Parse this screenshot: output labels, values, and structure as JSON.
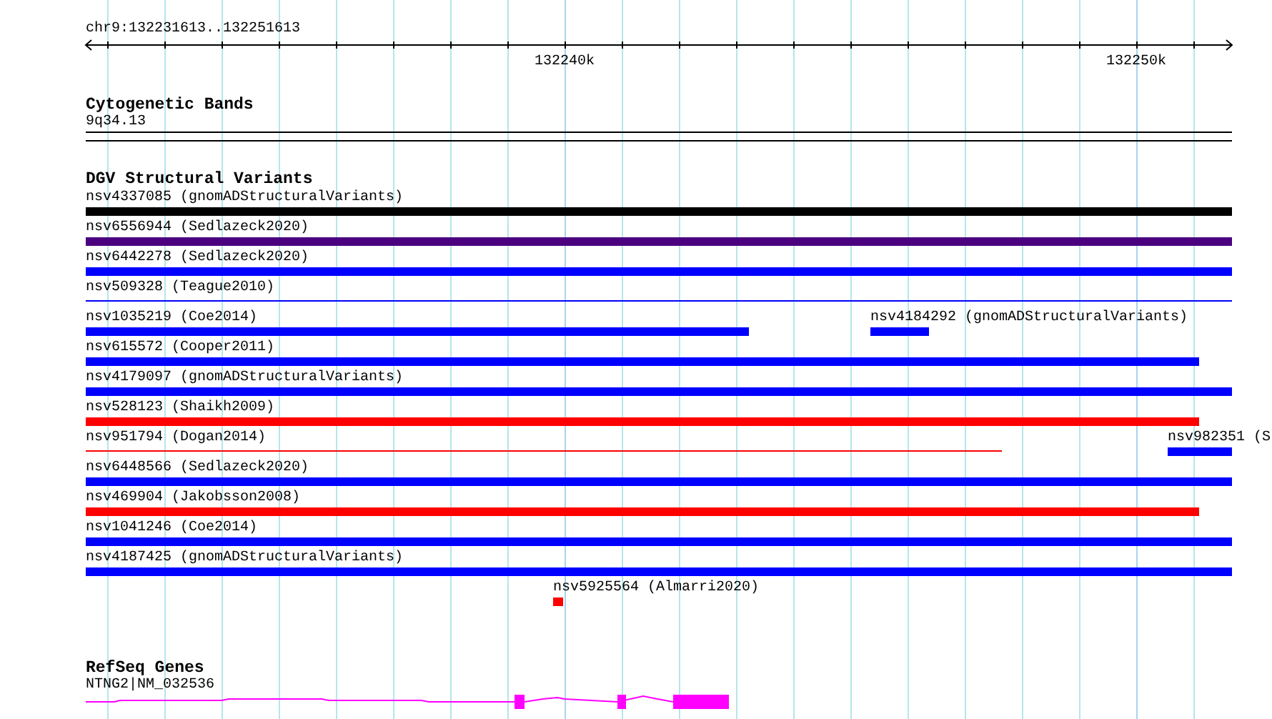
{
  "ruler": {
    "location": "chr9:132231613..132251613",
    "tick_labels": [
      "132240k",
      "132250k"
    ]
  },
  "cytogenetic_bands": {
    "title": "Cytogenetic Bands",
    "band": "9q34.13"
  },
  "dgv_structural_variants": {
    "title": "DGV Structural Variants",
    "rows": [
      {
        "features": [
          {
            "label": "nsv4337085 (gnomADStructuralVariants)",
            "kind": "bar",
            "color": "#000000"
          }
        ]
      },
      {
        "features": [
          {
            "label": "nsv6556944 (Sedlazeck2020)",
            "kind": "bar",
            "color": "#4b0080"
          }
        ]
      },
      {
        "features": [
          {
            "label": "nsv6442278 (Sedlazeck2020)",
            "kind": "bar",
            "color": "#0000ff"
          }
        ]
      },
      {
        "features": [
          {
            "label": "nsv509328 (Teague2010)",
            "kind": "line",
            "color": "#0000ff"
          }
        ]
      },
      {
        "features": [
          {
            "label": "nsv1035219 (Coe2014)",
            "kind": "bar",
            "color": "#0000ff"
          },
          {
            "label": "nsv4184292 (gnomADStructuralVariants)",
            "kind": "bar",
            "color": "#0000ff"
          }
        ]
      },
      {
        "features": [
          {
            "label": "nsv615572 (Cooper2011)",
            "kind": "bar",
            "color": "#0000ff"
          }
        ]
      },
      {
        "features": [
          {
            "label": "nsv4179097 (gnomADStructuralVariants)",
            "kind": "bar",
            "color": "#0000ff"
          }
        ]
      },
      {
        "features": [
          {
            "label": "nsv528123 (Shaikh2009)",
            "kind": "bar",
            "color": "#ff0000"
          }
        ]
      },
      {
        "features": [
          {
            "label": "nsv951794 (Dogan2014)",
            "kind": "line",
            "color": "#ff0000"
          },
          {
            "label": "nsv982351 (S",
            "kind": "bar",
            "color": "#0000ff"
          }
        ]
      },
      {
        "features": [
          {
            "label": "nsv6448566 (Sedlazeck2020)",
            "kind": "bar",
            "color": "#0000ff"
          }
        ]
      },
      {
        "features": [
          {
            "label": "nsv469904 (Jakobsson2008)",
            "kind": "bar",
            "color": "#ff0000"
          }
        ]
      },
      {
        "features": [
          {
            "label": "nsv1041246 (Coe2014)",
            "kind": "bar",
            "color": "#0000ff"
          }
        ]
      },
      {
        "features": [
          {
            "label": "nsv4187425 (gnomADStructuralVariants)",
            "kind": "bar",
            "color": "#0000ff"
          }
        ]
      },
      {
        "features": [
          {
            "label": "nsv5925564 (Almarri2020)",
            "kind": "bar",
            "color": "#ff0000"
          }
        ]
      }
    ]
  },
  "refseq_genes": {
    "title": "RefSeq Genes",
    "genes": [
      {
        "label": "NTNG2|NM_032536",
        "color": "#ff00ff"
      }
    ]
  }
}
